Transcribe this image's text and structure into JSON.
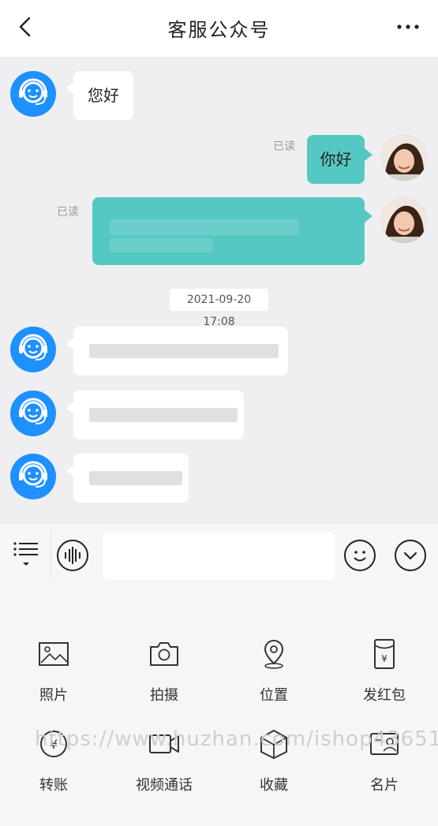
{
  "header": {
    "title": "客服公众号",
    "back_icon": "back-arrow-icon",
    "more_icon": "more-icon"
  },
  "messages": {
    "m1_text": "您好",
    "m2_text": "你好",
    "read_label": "已读"
  },
  "timestamp": "2021-09-20 17:08",
  "input": {
    "placeholder": "",
    "list_icon": "menu-list-icon",
    "voice_icon": "voice-icon",
    "emoji_icon": "emoji-icon",
    "expand_icon": "chevron-down-icon"
  },
  "tools": [
    {
      "label": "照片",
      "icon": "photo-icon"
    },
    {
      "label": "拍摄",
      "icon": "camera-icon"
    },
    {
      "label": "位置",
      "icon": "location-icon"
    },
    {
      "label": "发红包",
      "icon": "red-packet-icon"
    },
    {
      "label": "转账",
      "icon": "transfer-icon"
    },
    {
      "label": "视频通话",
      "icon": "video-call-icon"
    },
    {
      "label": "收藏",
      "icon": "favorites-icon"
    },
    {
      "label": "名片",
      "icon": "contact-card-icon"
    }
  ],
  "watermark": "https://www.huzhan.com/ishop43651",
  "colors": {
    "accent": "#1e90ff",
    "bubble_out": "#56c8c4"
  }
}
